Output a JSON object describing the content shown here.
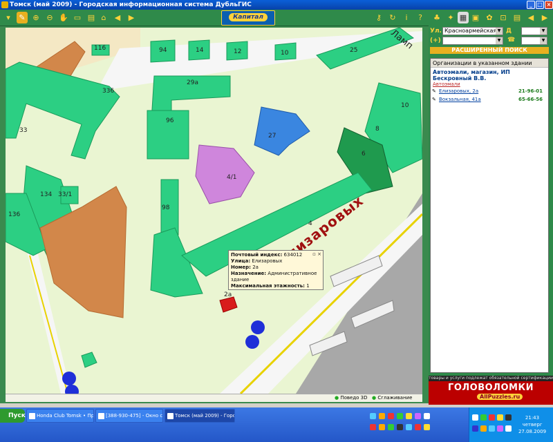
{
  "window": {
    "title": "Томск (май 2009) - Городская информационная система ДубльГИС"
  },
  "logo": {
    "text": "Капитал"
  },
  "search": {
    "street_label": "Ул.",
    "street_value": "Красноармейская",
    "house_label": "Д",
    "phone_label": "(+)",
    "advanced_label": "РАСШИРЕННЫЙ ПОИСК"
  },
  "org_panel": {
    "header": "Организации в указанном здании",
    "name": "Автоэмали, магазин, ИП Бескровный В.В.",
    "category": "Автоэмали",
    "rows": [
      {
        "address": "Елизаровых, 2а",
        "phone": "21-96-01"
      },
      {
        "address": "Вокзальная, 41а",
        "phone": "65-66-56"
      }
    ]
  },
  "banner": {
    "top": "товары и услуги подлежат обязательной сертификации",
    "title": "ГОЛОВОЛОМКИ",
    "sub": "AllPuzzles.ru"
  },
  "map": {
    "street_main": "Елизаровых",
    "street_top": "Ламп",
    "buildings": [
      "116",
      "94",
      "14",
      "12",
      "10",
      "25",
      "336",
      "29а",
      "10",
      "33",
      "96",
      "27",
      "8",
      "6",
      "134",
      "33/1",
      "4/1",
      "136",
      "98",
      "4",
      "2а"
    ],
    "popup": {
      "index_label": "Почтовый индекс:",
      "index": "634012",
      "street_label": "Улица:",
      "street": "Елизаровых",
      "number_label": "Номер:",
      "number": "2а",
      "purpose_label": "Назначение:",
      "purpose": "Административное здание",
      "floors_label": "Максимальная этажность:",
      "floors": "1"
    },
    "status": {
      "view3d": "Поведо 3D",
      "smooth": "Сглаживание"
    }
  },
  "taskbar": {
    "start": "Пуск",
    "tasks": [
      "Honda Club Tomsk • Про...",
      "[388-930-475] - Окно со...",
      "Томск (май 2009) - Горо..."
    ],
    "time": "21:43",
    "day": "четверг",
    "date": "27.08.2009"
  }
}
